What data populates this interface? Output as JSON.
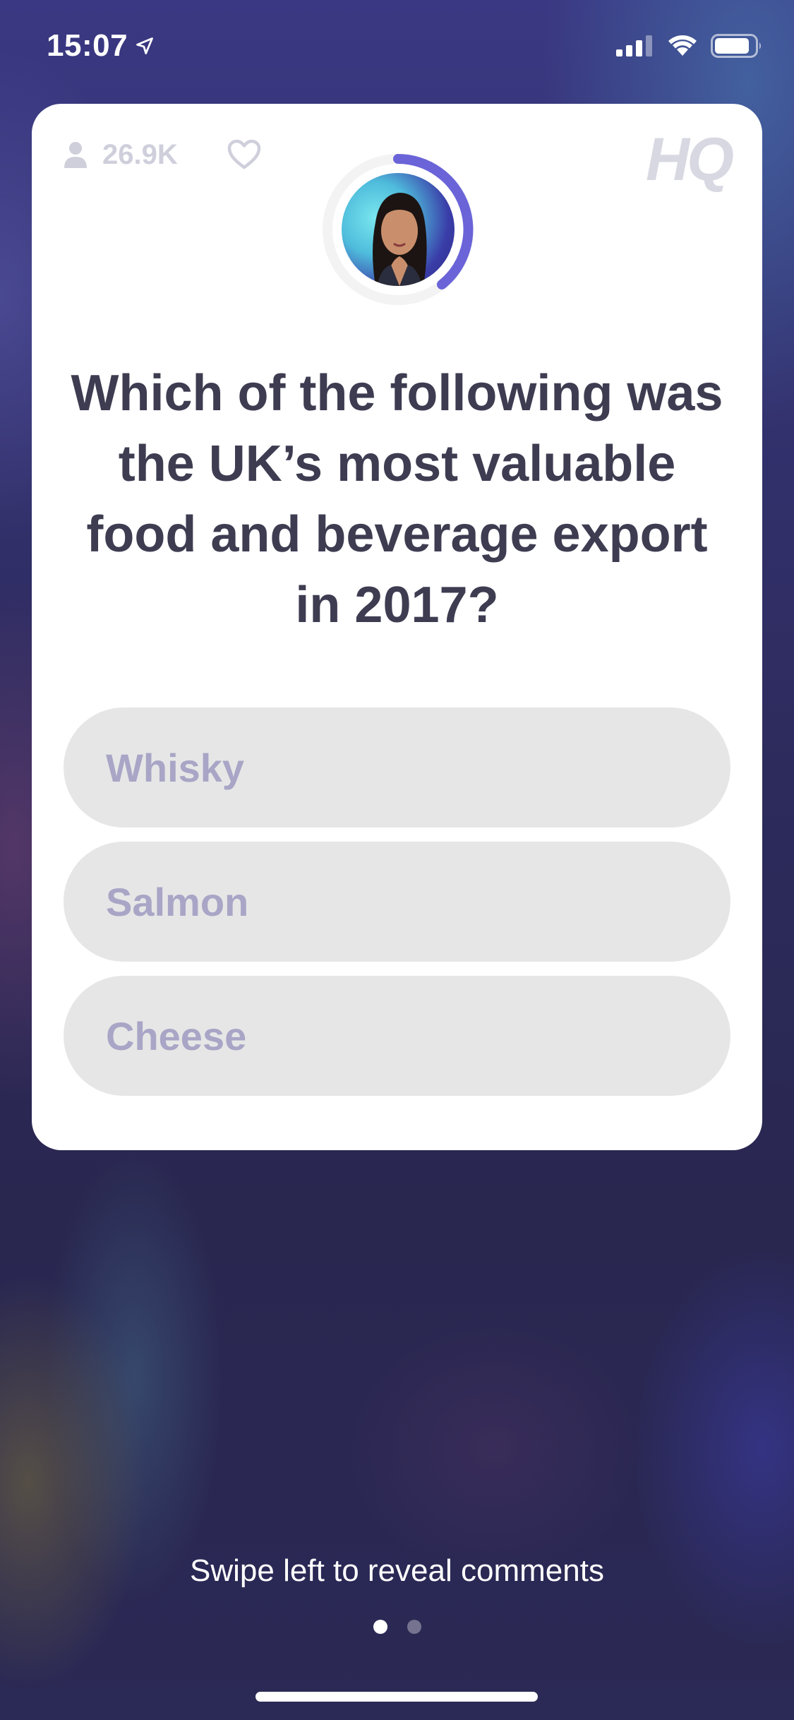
{
  "status_bar": {
    "time": "15:07",
    "icons": [
      "location-arrow-icon",
      "cellular-signal-icon",
      "wifi-icon",
      "battery-icon"
    ]
  },
  "card": {
    "viewer_count": "26.9K",
    "logo_text": "HQ",
    "icons": [
      "person-icon",
      "heart-icon"
    ],
    "host_timer_color": "#6a64d8",
    "question": "Which of the following was the UK’s most valuable food and beverage export in 2017?",
    "answers": [
      {
        "label": "Whisky"
      },
      {
        "label": "Salmon"
      },
      {
        "label": "Cheese"
      }
    ]
  },
  "footer": {
    "swipe_hint": "Swipe left to reveal comments",
    "pages": 2,
    "active_page": 1
  },
  "colors": {
    "question_text": "#3d3c51",
    "answer_bg": "#e6e6e6",
    "answer_text": "#a8a5c6",
    "background": "#2a2850"
  }
}
